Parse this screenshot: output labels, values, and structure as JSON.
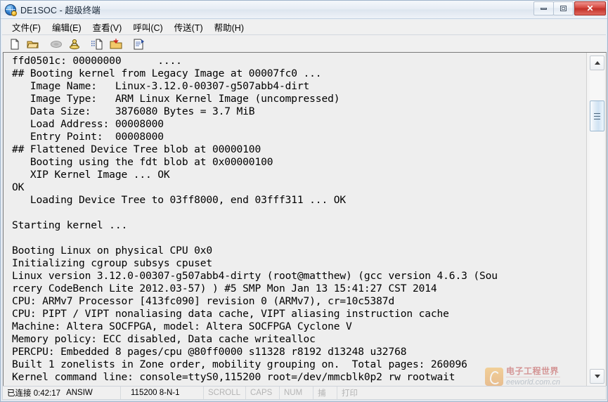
{
  "window": {
    "title": "DE1SOC - 超级终端",
    "icon": "globe-icon",
    "buttons": {
      "minimize": "minimize-icon",
      "maximize": "maximize-icon",
      "close": "✕"
    }
  },
  "menubar": {
    "items": [
      {
        "label": "文件(F)",
        "name": "menu-file"
      },
      {
        "label": "编辑(E)",
        "name": "menu-edit"
      },
      {
        "label": "查看(V)",
        "name": "menu-view"
      },
      {
        "label": "呼叫(C)",
        "name": "menu-call"
      },
      {
        "label": "传送(T)",
        "name": "menu-transfer"
      },
      {
        "label": "帮助(H)",
        "name": "menu-help"
      }
    ]
  },
  "toolbar": {
    "buttons": [
      {
        "name": "new-connection-icon",
        "title": "新建连接"
      },
      {
        "name": "open-folder-icon",
        "title": "打开"
      },
      {
        "name": "call-phone-icon",
        "title": "呼叫",
        "disabled": true
      },
      {
        "name": "disconnect-phone-icon",
        "title": "断开"
      },
      {
        "name": "send-file-icon",
        "title": "发送文件"
      },
      {
        "name": "receive-file-icon",
        "title": "接收文件"
      },
      {
        "name": "properties-icon",
        "title": "属性"
      }
    ]
  },
  "terminal": {
    "lines": [
      "ffd0501c: 00000000      ....",
      "## Booting kernel from Legacy Image at 00007fc0 ...",
      "   Image Name:   Linux-3.12.0-00307-g507abb4-dirt",
      "   Image Type:   ARM Linux Kernel Image (uncompressed)",
      "   Data Size:    3876080 Bytes = 3.7 MiB",
      "   Load Address: 00008000",
      "   Entry Point:  00008000",
      "## Flattened Device Tree blob at 00000100",
      "   Booting using the fdt blob at 0x00000100",
      "   XIP Kernel Image ... OK",
      "OK",
      "   Loading Device Tree to 03ff8000, end 03fff311 ... OK",
      "",
      "Starting kernel ...",
      "",
      "Booting Linux on physical CPU 0x0",
      "Initializing cgroup subsys cpuset",
      "Linux version 3.12.0-00307-g507abb4-dirty (root@matthew) (gcc version 4.6.3 (Sou",
      "rcery CodeBench Lite 2012.03-57) ) #5 SMP Mon Jan 13 15:41:27 CST 2014",
      "CPU: ARMv7 Processor [413fc090] revision 0 (ARMv7), cr=10c5387d",
      "CPU: PIPT / VIPT nonaliasing data cache, VIPT aliasing instruction cache",
      "Machine: Altera SOCFPGA, model: Altera SOCFPGA Cyclone V",
      "Memory policy: ECC disabled, Data cache writealloc",
      "PERCPU: Embedded 8 pages/cpu @80ff0000 s11328 r8192 d13248 u32768",
      "Built 1 zonelists in Zone order, mobility grouping on.  Total pages: 260096",
      "Kernel command line: console=ttyS0,115200 root=/dev/mmcblk0p2 rw rootwait"
    ]
  },
  "scrollbar": {
    "up_arrow": "scroll-up-icon",
    "down_arrow": "scroll-down-icon",
    "thumb": "scroll-thumb"
  },
  "statusbar": {
    "connection": "已连接 0:42:17",
    "emulation": "ANSIW",
    "line_settings": "115200 8-N-1",
    "scroll": "SCROLL",
    "caps": "CAPS",
    "num": "NUM",
    "capture": "捕",
    "print": "打印"
  },
  "watermark": {
    "cn": "电子工程世界",
    "en": "eeworld.com.cn"
  },
  "colors": {
    "terminal_bg": "#eeeeee",
    "terminal_fg": "#000000",
    "close_button": "#c23129",
    "accent": "#cfe2f3"
  }
}
